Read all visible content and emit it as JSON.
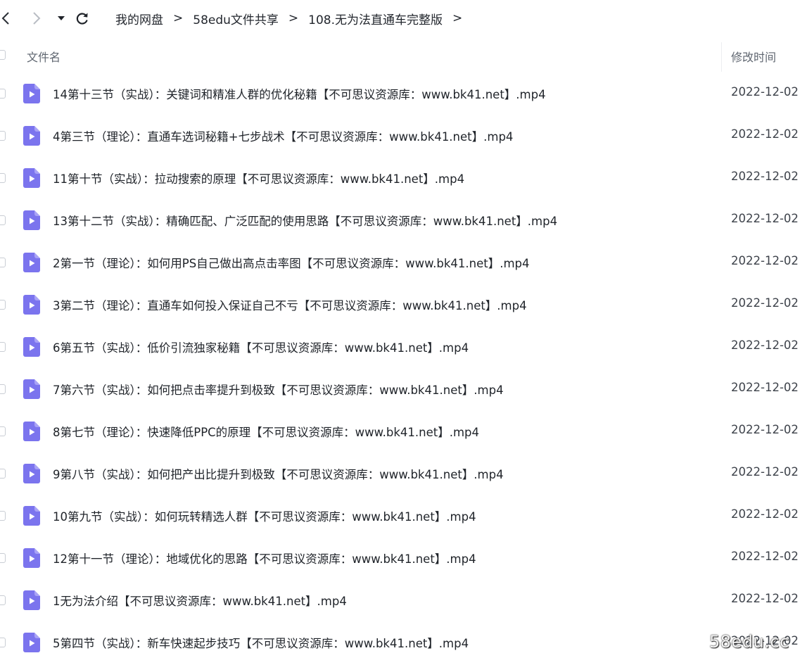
{
  "breadcrumb": {
    "items": [
      "我的网盘",
      "58edu文件共享",
      "108.无为法直通车完整版"
    ],
    "separator": ">"
  },
  "table": {
    "col_name": "文件名",
    "col_time": "修改时间"
  },
  "files": [
    {
      "name": "14第十三节（实战）：关键词和精准人群的优化秘籍【不可思议资源库：www.bk41.net】.mp4",
      "date": "2022-12-02"
    },
    {
      "name": "4第三节（理论）：直通车选词秘籍+七步战术【不可思议资源库：www.bk41.net】.mp4",
      "date": "2022-12-02"
    },
    {
      "name": "11第十节（实战）：拉动搜索的原理【不可思议资源库：www.bk41.net】.mp4",
      "date": "2022-12-02"
    },
    {
      "name": "13第十二节（实战）：精确匹配、广泛匹配的使用思路【不可思议资源库：www.bk41.net】.mp4",
      "date": "2022-12-02"
    },
    {
      "name": "2第一节（理论）：如何用PS自己做出高点击率图【不可思议资源库：www.bk41.net】.mp4",
      "date": "2022-12-02"
    },
    {
      "name": "3第二节（理论）：直通车如何投入保证自己不亏【不可思议资源库：www.bk41.net】.mp4",
      "date": "2022-12-02"
    },
    {
      "name": "6第五节（实战）：低价引流独家秘籍【不可思议资源库：www.bk41.net】.mp4",
      "date": "2022-12-02"
    },
    {
      "name": "7第六节（实战）：如何把点击率提升到极致【不可思议资源库：www.bk41.net】.mp4",
      "date": "2022-12-02"
    },
    {
      "name": "8第七节（理论）：快速降低PPC的原理【不可思议资源库：www.bk41.net】.mp4",
      "date": "2022-12-02"
    },
    {
      "name": "9第八节（实战）：如何把产出比提升到极致【不可思议资源库：www.bk41.net】.mp4",
      "date": "2022-12-02"
    },
    {
      "name": "10第九节（实战）：如何玩转精选人群【不可思议资源库：www.bk41.net】.mp4",
      "date": "2022-12-02"
    },
    {
      "name": "12第十一节（理论）：地域优化的思路【不可思议资源库：www.bk41.net】.mp4",
      "date": "2022-12-02"
    },
    {
      "name": "1无为法介绍【不可思议资源库：www.bk41.net】.mp4",
      "date": "2022-12-02"
    },
    {
      "name": "5第四节（实战）：新车快速起步技巧【不可思议资源库：www.bk41.net】.mp4",
      "date": "2022-12-02"
    }
  ],
  "watermark": "58edu.cc",
  "icons": {
    "back": "chevron-left-icon",
    "forward": "chevron-right-icon",
    "dropdown": "caret-down-icon",
    "refresh": "refresh-icon",
    "file": "video-file-icon"
  },
  "colors": {
    "file_icon": "#7b74ee",
    "file_icon_fold": "#a9a3f6",
    "text": "#1f2329",
    "muted": "#5f6670"
  }
}
